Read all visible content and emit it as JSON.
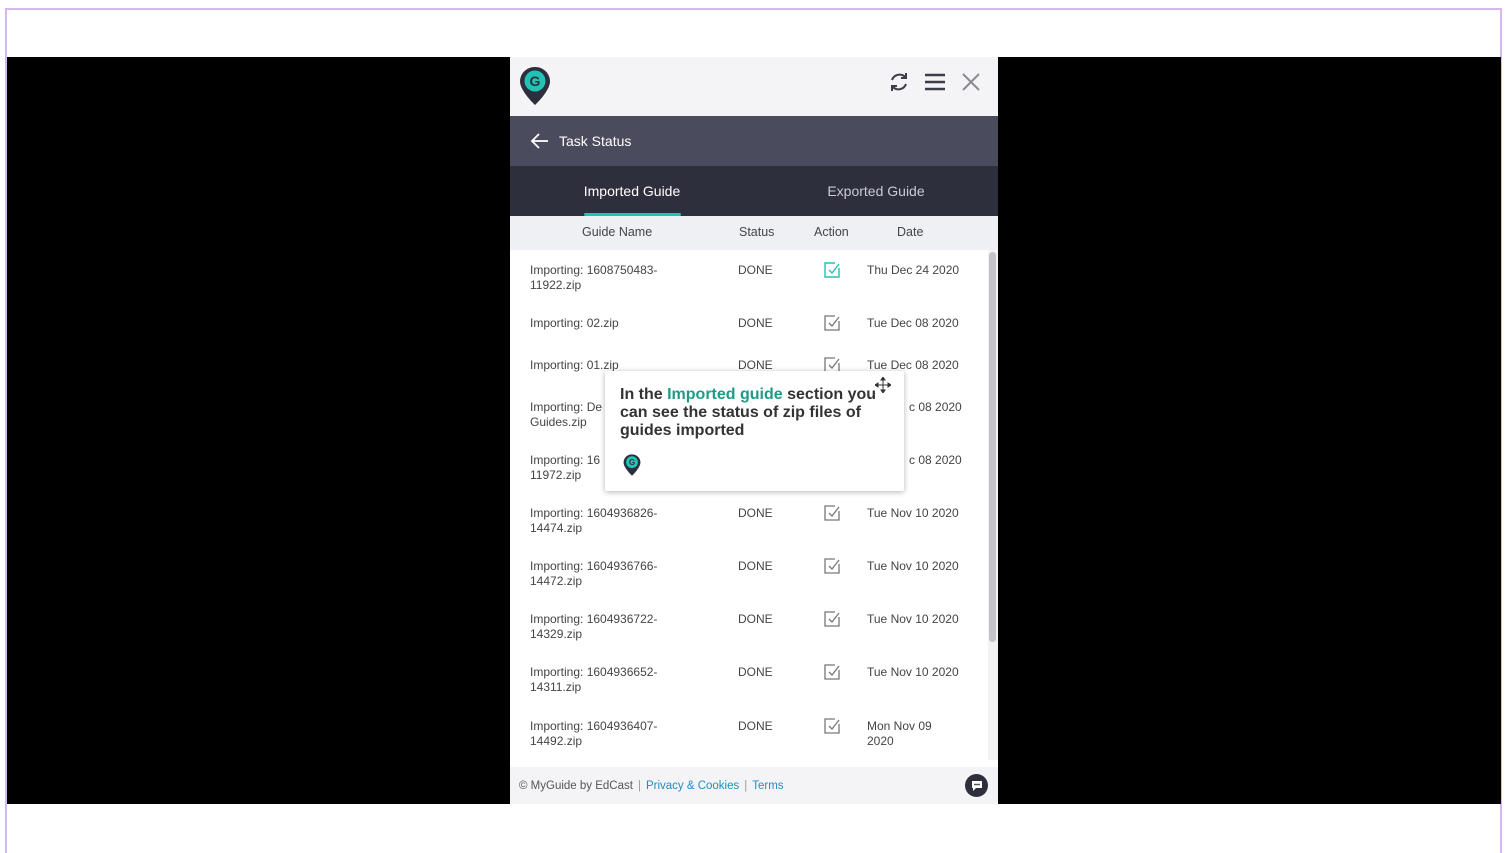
{
  "header": {
    "logo_letter": "G",
    "icons": [
      "refresh-icon",
      "menu-icon",
      "close-icon"
    ]
  },
  "titlebar": {
    "title": "Task Status"
  },
  "tabs": [
    {
      "label": "Imported Guide",
      "active": true
    },
    {
      "label": "Exported Guide",
      "active": false
    }
  ],
  "table": {
    "columns": [
      "Guide Name",
      "Status",
      "Action",
      "Date"
    ],
    "rows": [
      {
        "name": "Importing: 1608750483-11922.zip",
        "status": "DONE",
        "date": "Thu Dec 24 2020"
      },
      {
        "name": "Importing: 02.zip",
        "status": "DONE",
        "date": "Tue Dec 08 2020"
      },
      {
        "name": "Importing: 01.zip",
        "status": "DONE",
        "date": "Tue Dec 08 2020"
      },
      {
        "name": "Importing: De",
        "name2": "Guides.zip",
        "status": "",
        "date": "c 08 2020"
      },
      {
        "name": "Importing: 16",
        "name2": "11972.zip",
        "status": "",
        "date": "c 08 2020"
      },
      {
        "name": "Importing: 1604936826-14474.zip",
        "status": "DONE",
        "date": "Tue Nov 10 2020"
      },
      {
        "name": "Importing: 1604936766-14472.zip",
        "status": "DONE",
        "date": "Tue Nov 10 2020"
      },
      {
        "name": "Importing: 1604936722-14329.zip",
        "status": "DONE",
        "date": "Tue Nov 10 2020"
      },
      {
        "name": "Importing: 1604936652-14311.zip",
        "status": "DONE",
        "date": "Tue Nov 10 2020"
      },
      {
        "name": "Importing: 1604936407-14492.zip",
        "status": "DONE",
        "date": "Mon Nov 09 2020"
      }
    ]
  },
  "footer": {
    "copyright": "© MyGuide by EdCast",
    "privacy": "Privacy & Cookies",
    "terms": "Terms",
    "separator": "|"
  },
  "tooltip": {
    "prefix": "In the ",
    "highlight": "Imported guide",
    "suffix": " section you can see the status of zip files of guides imported"
  },
  "colors": {
    "accent": "#20c3b4",
    "highlight": "#1f9a86",
    "titlebar": "#4a4b5c",
    "tabbar": "#2e2f3d",
    "link": "#1e8fc4"
  }
}
